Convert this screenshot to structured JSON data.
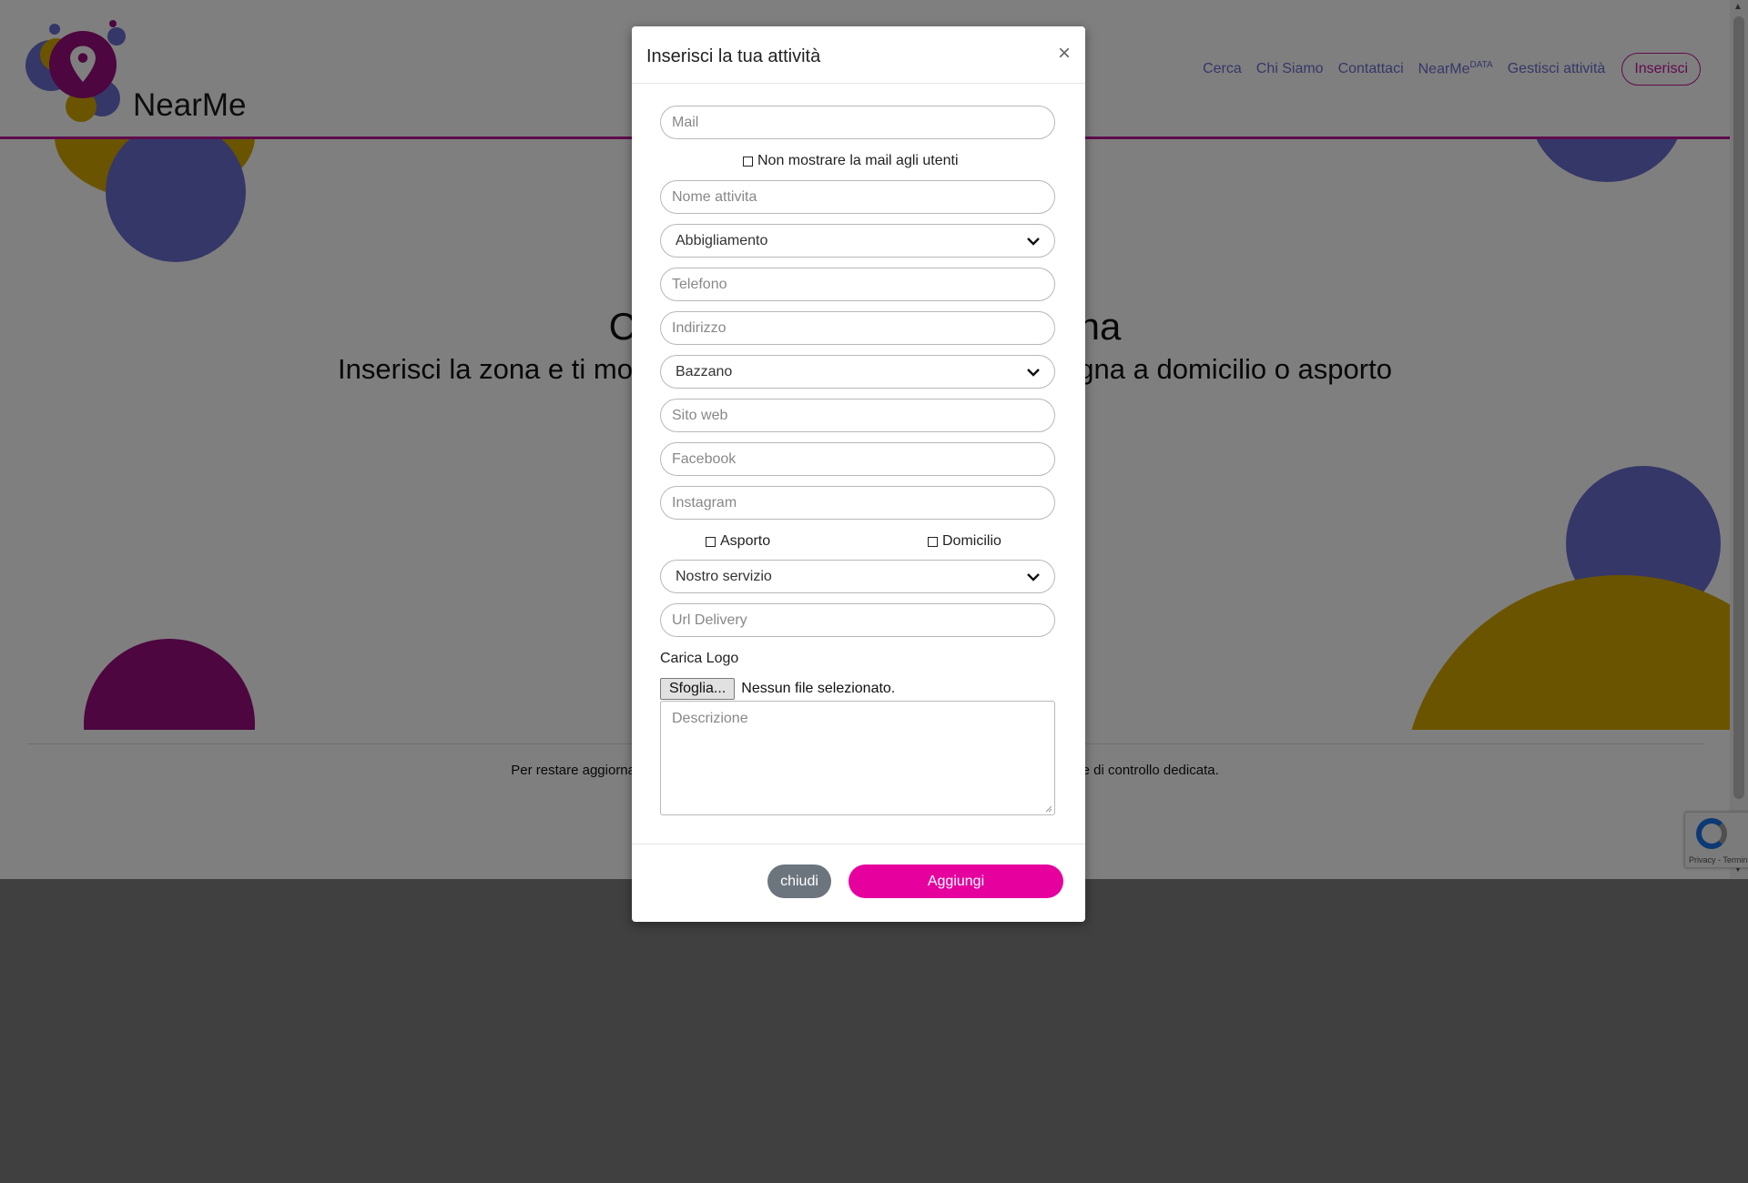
{
  "brand": {
    "name": "NearMe"
  },
  "nav": {
    "links": [
      "Cerca",
      "Chi Siamo",
      "Contattaci"
    ],
    "data_label": "NearMe",
    "data_sup": "DATA",
    "manage": "Gestisci attività",
    "insert": "Inserisci"
  },
  "hero": {
    "title": "Cerca le attività nella tua zona",
    "subtitle": "Inserisci la zona e ti mostreremo le attività che fanno consegna a domicilio o asporto"
  },
  "footer": {
    "text": "Per restare aggiornato sull'andamento delle attività nella tua zona scarica la nostra applicazione di controllo dedicata."
  },
  "recaptcha": {
    "text": "Privacy - Termini"
  },
  "modal": {
    "title": "Inserisci la tua attività",
    "close_symbol": "×",
    "mail_placeholder": "Mail",
    "hide_mail_label": "Non mostrare la mail agli utenti",
    "name_placeholder": "Nome attivita",
    "category_value": "Abbigliamento",
    "phone_placeholder": "Telefono",
    "address_placeholder": "Indirizzo",
    "city_value": "Bazzano",
    "website_placeholder": "Sito web",
    "facebook_placeholder": "Facebook",
    "instagram_placeholder": "Instagram",
    "takeaway_label": "Asporto",
    "delivery_label": "Domicilio",
    "service_value": "Nostro servizio",
    "url_delivery_placeholder": "Url Delivery",
    "logo_label": "Carica Logo",
    "file_button": "Sfoglia...",
    "file_status": "Nessun file selezionato.",
    "description_placeholder": "Descrizione",
    "close_button": "chiudi",
    "add_button": "Aggiungi"
  },
  "colors": {
    "accent": "#e6009e",
    "brand_purple": "#9b0c7f",
    "blue": "#6a6fd0",
    "yellow": "#d6a800",
    "gray_button": "#6c757d"
  },
  "icons": {
    "logo": "map-pin-icon",
    "select": "chevron-down-icon",
    "close": "close-icon"
  }
}
